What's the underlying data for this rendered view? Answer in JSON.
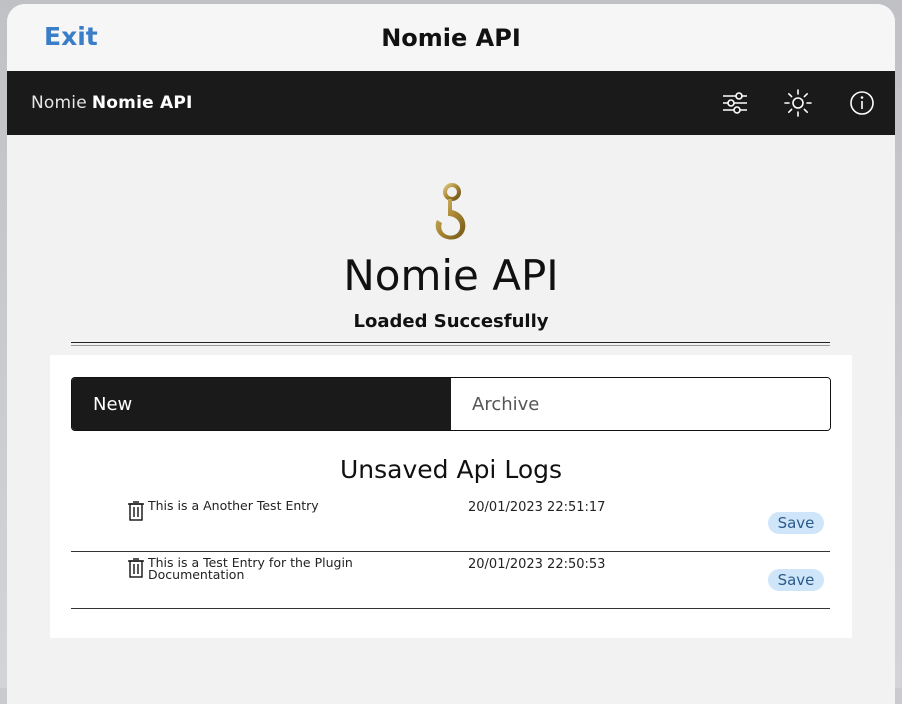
{
  "sheet": {
    "exit_label": "Exit",
    "title": "Nomie API"
  },
  "app_bar": {
    "brand_light": "Nomie",
    "brand_bold": "Nomie API",
    "icons": [
      "sliders-icon",
      "brightness-icon",
      "info-icon"
    ]
  },
  "hero": {
    "icon": "hook-icon",
    "title": "Nomie API",
    "subtitle": "Loaded Succesfully"
  },
  "tabs": [
    {
      "label": "New",
      "active": true
    },
    {
      "label": "Archive",
      "active": false
    }
  ],
  "logs": {
    "title": "Unsaved Api Logs",
    "entries": [
      {
        "text": "This is a Another Test Entry",
        "time": "20/01/2023 22:51:17",
        "action": "Save"
      },
      {
        "text": "This is a Test Entry for the Plugin Documentation",
        "time": "20/01/2023 22:50:53",
        "action": "Save"
      }
    ]
  },
  "colors": {
    "accent": "#3a7dc9",
    "bar_bg": "#1a1a1a",
    "save_bg": "#cfe6fa"
  }
}
